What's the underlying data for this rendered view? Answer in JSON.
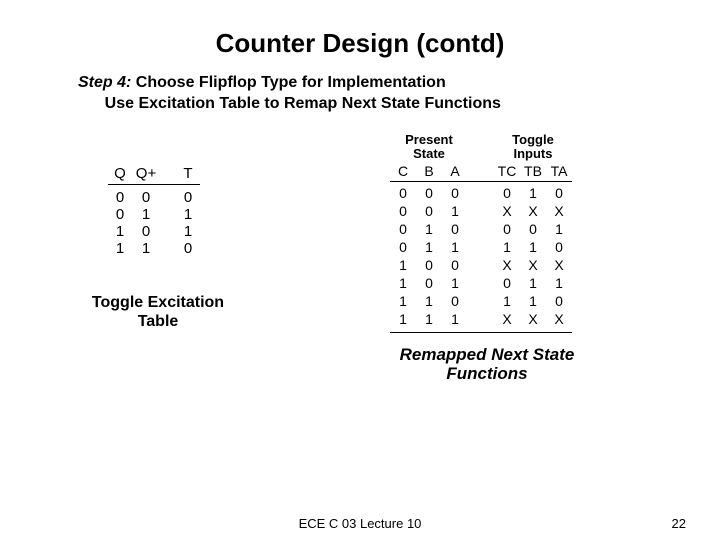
{
  "title": "Counter Design (contd)",
  "step": {
    "label": "Step 4:",
    "line1": "Choose Flipflop Type for Implementation",
    "line2": "Use Excitation Table to Remap Next State Functions"
  },
  "excitation": {
    "headers": {
      "q": "Q",
      "qp": "Q+",
      "t": "T"
    },
    "rows": [
      {
        "q": "0",
        "qp": "0",
        "t": "0"
      },
      {
        "q": "0",
        "qp": "1",
        "t": "1"
      },
      {
        "q": "1",
        "qp": "0",
        "t": "1"
      },
      {
        "q": "1",
        "qp": "1",
        "t": "0"
      }
    ],
    "caption1": "Toggle Excitation",
    "caption2": "Table"
  },
  "remap": {
    "ps_label1": "Present",
    "ps_label2": "State",
    "ti_label1": "Toggle",
    "ti_label2": "Inputs",
    "cols": {
      "c": "C",
      "b": "B",
      "a": "A",
      "tc": "TC",
      "tb": "TB",
      "ta": "TA"
    },
    "rows": [
      {
        "c": "0",
        "b": "0",
        "a": "0",
        "tc": "0",
        "tb": "1",
        "ta": "0"
      },
      {
        "c": "0",
        "b": "0",
        "a": "1",
        "tc": "X",
        "tb": "X",
        "ta": "X"
      },
      {
        "c": "0",
        "b": "1",
        "a": "0",
        "tc": "0",
        "tb": "0",
        "ta": "1"
      },
      {
        "c": "0",
        "b": "1",
        "a": "1",
        "tc": "1",
        "tb": "1",
        "ta": "0"
      },
      {
        "c": "1",
        "b": "0",
        "a": "0",
        "tc": "X",
        "tb": "X",
        "ta": "X"
      },
      {
        "c": "1",
        "b": "0",
        "a": "1",
        "tc": "0",
        "tb": "1",
        "ta": "1"
      },
      {
        "c": "1",
        "b": "1",
        "a": "0",
        "tc": "1",
        "tb": "1",
        "ta": "0"
      },
      {
        "c": "1",
        "b": "1",
        "a": "1",
        "tc": "X",
        "tb": "X",
        "ta": "X"
      }
    ],
    "caption1": "Remapped Next State",
    "caption2": "Functions"
  },
  "footer": {
    "center": "ECE C 03 Lecture 10",
    "page": "22"
  }
}
